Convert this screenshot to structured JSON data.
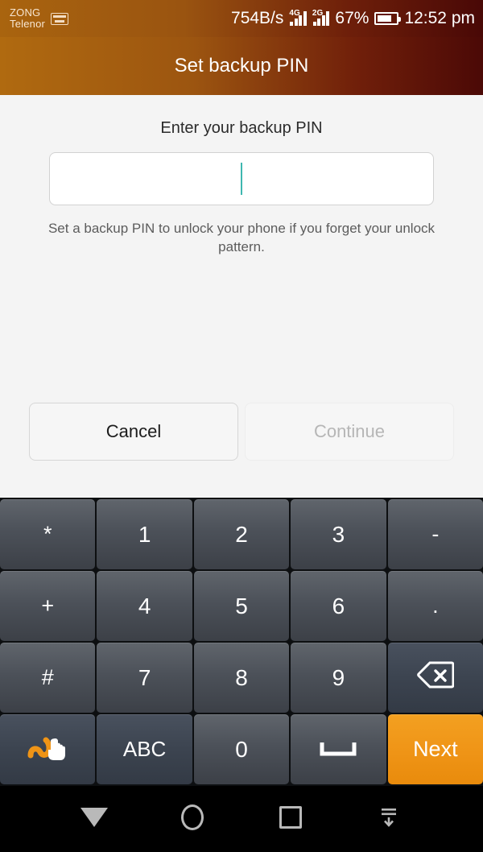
{
  "status_bar": {
    "carrier_primary": "ZONG",
    "carrier_secondary": "Telenor",
    "keyboard_indicator_icon": "keyboard-icon",
    "network_speed": "754B/s",
    "signal_1_generation": "4G",
    "signal_2_generation": "2G",
    "battery_percent": "67%",
    "time": "12:52 pm"
  },
  "header": {
    "title": "Set backup PIN"
  },
  "main": {
    "prompt": "Enter your backup PIN",
    "pin_field": {
      "value": "",
      "placeholder": ""
    },
    "hint": "Set a backup PIN to unlock your phone if you forget your unlock pattern.",
    "buttons": {
      "cancel": "Cancel",
      "continue": "Continue"
    }
  },
  "keyboard": {
    "rows": [
      [
        {
          "label": "*",
          "name": "key-asterisk",
          "style": "sym"
        },
        {
          "label": "1",
          "name": "key-1",
          "style": "num"
        },
        {
          "label": "2",
          "name": "key-2",
          "style": "num"
        },
        {
          "label": "3",
          "name": "key-3",
          "style": "num"
        },
        {
          "label": "-",
          "name": "key-hyphen",
          "style": "sym"
        }
      ],
      [
        {
          "label": "+",
          "name": "key-plus",
          "style": "sym"
        },
        {
          "label": "4",
          "name": "key-4",
          "style": "num"
        },
        {
          "label": "5",
          "name": "key-5",
          "style": "num"
        },
        {
          "label": "6",
          "name": "key-6",
          "style": "num"
        },
        {
          "label": ".",
          "name": "key-period",
          "style": "sym"
        }
      ],
      [
        {
          "label": "#",
          "name": "key-hash",
          "style": "sym"
        },
        {
          "label": "7",
          "name": "key-7",
          "style": "num"
        },
        {
          "label": "8",
          "name": "key-8",
          "style": "num"
        },
        {
          "label": "9",
          "name": "key-9",
          "style": "num"
        },
        {
          "label": "",
          "name": "key-backspace",
          "style": "fn",
          "icon": "backspace-icon"
        }
      ],
      [
        {
          "label": "",
          "name": "key-swipe-input",
          "style": "fn",
          "icon": "swipe-gesture-icon"
        },
        {
          "label": "ABC",
          "name": "key-abc",
          "style": "fn"
        },
        {
          "label": "0",
          "name": "key-0",
          "style": "num"
        },
        {
          "label": "",
          "name": "key-space",
          "style": "num",
          "icon": "space-icon"
        },
        {
          "label": "Next",
          "name": "key-next",
          "style": "accent"
        }
      ]
    ]
  },
  "navbar": {
    "back": "back-icon",
    "home": "home-icon",
    "recents": "recents-icon",
    "hide_keyboard": "hide-keyboard-icon"
  },
  "colors": {
    "header_start": "#b06a10",
    "header_end": "#4b0906",
    "accent_key": "#ef9416",
    "caret": "#3fb7b0",
    "content_bg": "#f4f4f4"
  }
}
